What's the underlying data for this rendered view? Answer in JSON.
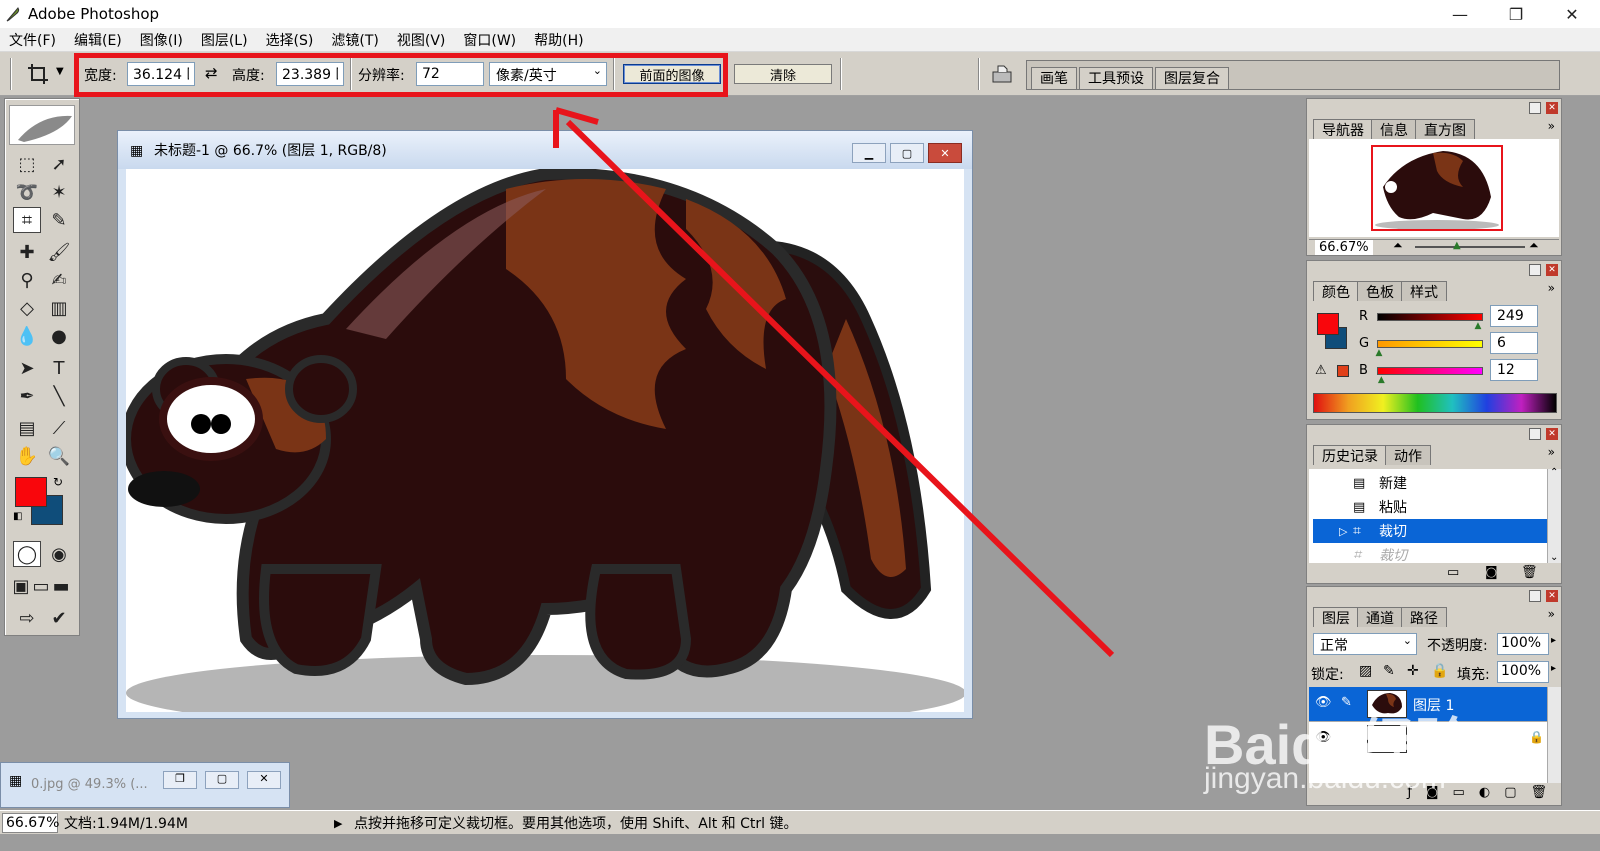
{
  "window": {
    "title": "Adobe Photoshop",
    "minimize": "—",
    "restore": "❐",
    "close": "✕"
  },
  "menu": [
    "文件(F)",
    "编辑(E)",
    "图像(I)",
    "图层(L)",
    "选择(S)",
    "滤镜(T)",
    "视图(V)",
    "窗口(W)",
    "帮助(H)"
  ],
  "options": {
    "width_label": "宽度:",
    "width_value": "36.124 匣",
    "height_label": "高度:",
    "height_value": "23.389 匣",
    "res_label": "分辨率:",
    "res_value": "72",
    "unit_value": "像素/英寸",
    "front_image_label": "前面的图像",
    "clear_label": "清除",
    "well_tabs": [
      "画笔",
      "工具预设",
      "图层复合"
    ]
  },
  "document": {
    "title": "未标题-1 @ 66.7% (图层 1, RGB/8)"
  },
  "minimized_doc": {
    "title": "0.jpg @ 49.3% (..."
  },
  "status": {
    "zoom": "66.67%",
    "doc_size": "文档:1.94M/1.94M",
    "hint": "点按并拖移可定义裁切框。要用其他选项，使用 Shift、Alt 和 Ctrl 键。"
  },
  "navigator": {
    "tabs": [
      "导航器",
      "信息",
      "直方图"
    ],
    "zoom": "66.67%"
  },
  "color": {
    "tabs": [
      "颜色",
      "色板",
      "样式"
    ],
    "r_label": "R",
    "g_label": "G",
    "b_label": "B",
    "r": "249",
    "g": "6",
    "b": "12",
    "r_frac": 0.976,
    "g_frac": 0.024,
    "b_frac": 0.047,
    "foreground": "#f9060c",
    "background": "#0f4d7a"
  },
  "history": {
    "tabs": [
      "历史记录",
      "动作"
    ],
    "items": [
      "新建",
      "粘贴",
      "裁切",
      "裁切"
    ]
  },
  "layers": {
    "tabs": [
      "图层",
      "通道",
      "路径"
    ],
    "blend": "正常",
    "opacity_label": "不透明度:",
    "opacity": "100%",
    "lock_label": "锁定:",
    "fill_label": "填充:",
    "fill": "100%",
    "layer_name": "图层 1"
  },
  "watermark": {
    "brand": "Baidu经验",
    "url": "jingyan.baidu.com"
  },
  "colors": {
    "annotation_red": "#e8141b",
    "selection_blue": "#0a65d6"
  }
}
